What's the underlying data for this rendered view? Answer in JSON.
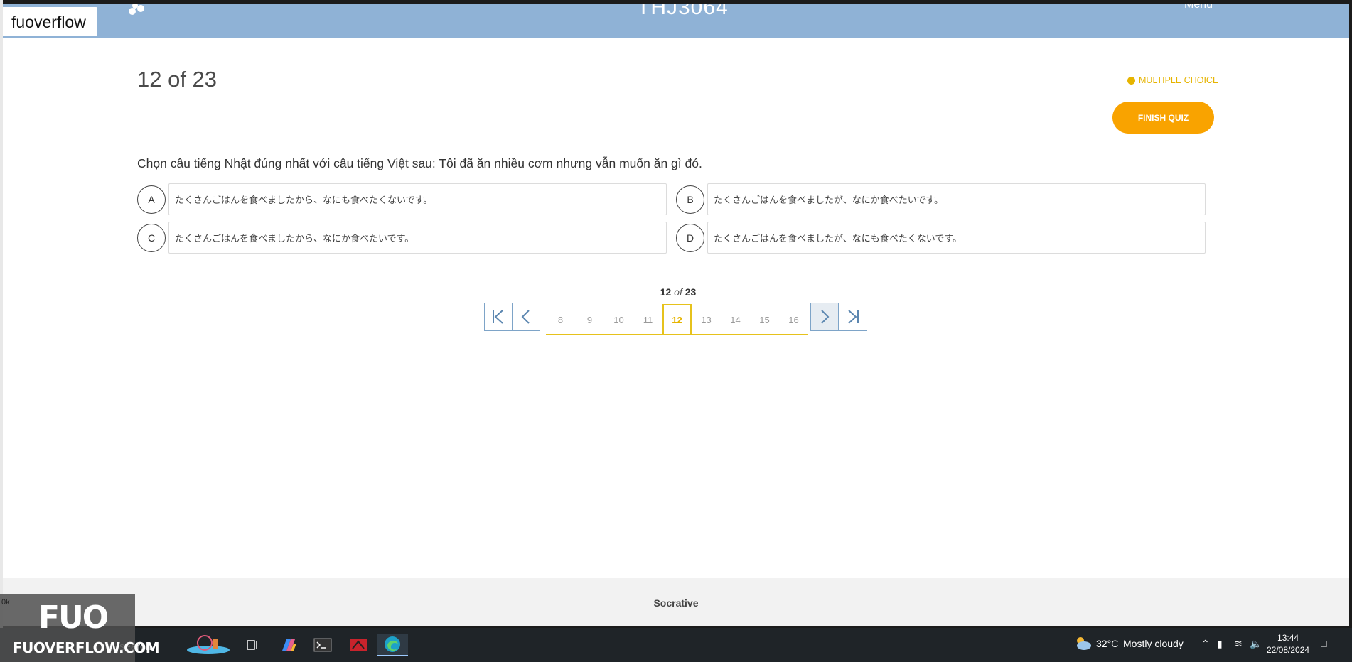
{
  "brand": "fuoverflow",
  "header": {
    "title": "THJ3064",
    "menu_label": "Menu"
  },
  "quiz": {
    "counter": "12 of 23",
    "type_label": "MULTIPLE CHOICE",
    "finish_label": "FINISH QUIZ",
    "question": "Chọn câu tiếng Nhật đúng nhất với câu tiếng Việt sau: Tôi đã ăn nhiều cơm nhưng vẫn muốn ăn gì đó.",
    "options": [
      {
        "letter": "A",
        "text": "たくさんごはんを食べましたから、なにも食べたくないです。"
      },
      {
        "letter": "B",
        "text": "たくさんごはんを食べましたが、なにか食べたいです。"
      },
      {
        "letter": "C",
        "text": "たくさんごはんを食べましたから、なにか食べたいです。"
      },
      {
        "letter": "D",
        "text": "たくさんごはんを食べましたが、なにも食べたくないです。"
      }
    ]
  },
  "pager": {
    "current": "12",
    "of": "of",
    "total": "23",
    "pages": [
      "8",
      "9",
      "10",
      "11",
      "12",
      "13",
      "14",
      "15",
      "16"
    ]
  },
  "footer": {
    "name": "Socrative"
  },
  "taskbar": {
    "search": "search",
    "weather": "32°C",
    "weather_desc": "Mostly cloudy",
    "time": "13:44",
    "date": "22/08/2024"
  },
  "watermark": {
    "big": "FUO",
    "small": "FUOVERFLOW.COM",
    "ok": "0k"
  },
  "colors": {
    "header": "#8fb2d6",
    "accent": "#f9a300",
    "pager": "#e6c21c"
  }
}
